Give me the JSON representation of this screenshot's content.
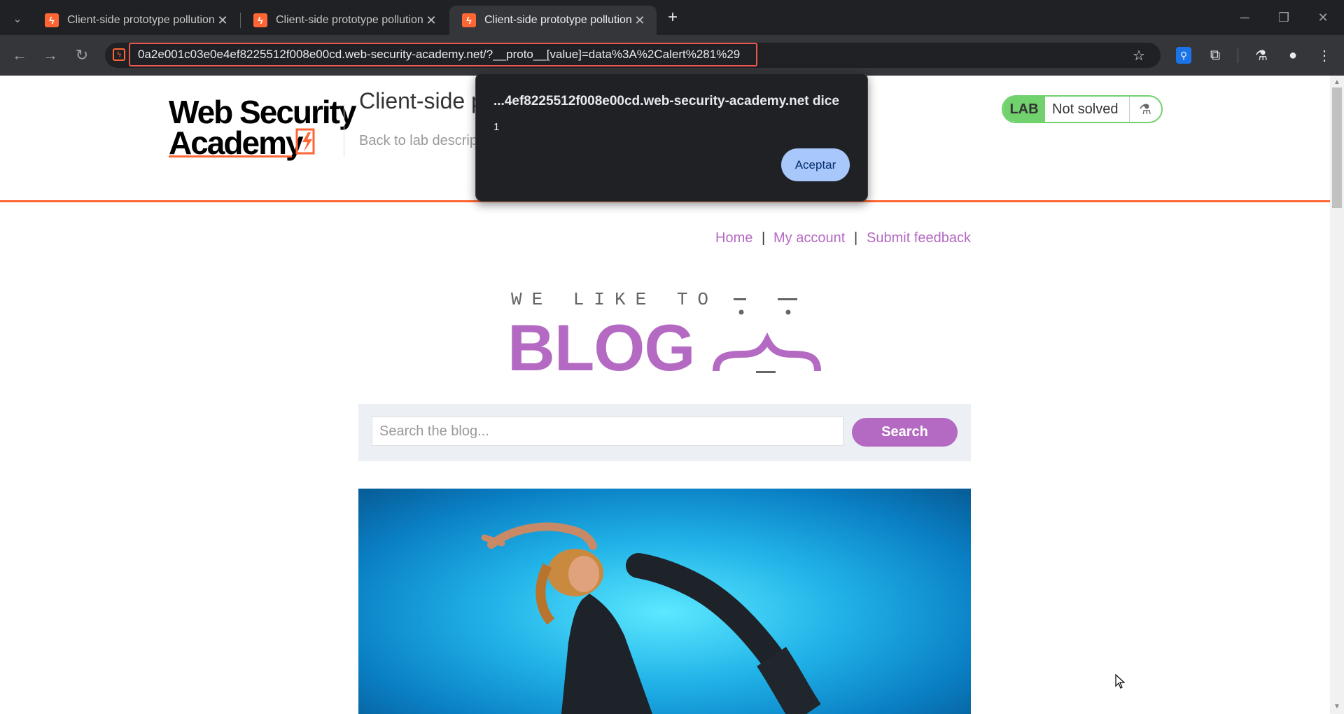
{
  "browser": {
    "tabs": [
      {
        "title": "Client-side prototype pollution",
        "active": false
      },
      {
        "title": "Client-side prototype pollution",
        "active": false
      },
      {
        "title": "Client-side prototype pollution",
        "active": true
      }
    ],
    "url": "0a2e001c03e0e4ef8225512f008e00cd.web-security-academy.net/?__proto__[value]=data%3A%2Calert%281%29"
  },
  "header": {
    "logo_line1": "Web Security",
    "logo_line2": "Academy",
    "lab_title": "Client-side p",
    "back_link": "Back to lab descrip",
    "lab_badge": "LAB",
    "lab_status": "Not solved"
  },
  "nav": {
    "home": "Home",
    "sep1": "|",
    "account": "My account",
    "sep2": "|",
    "feedback": "Submit feedback"
  },
  "blog": {
    "tagline": "WE LIKE TO",
    "title": "BLOG"
  },
  "search": {
    "placeholder": "Search the blog...",
    "button": "Search"
  },
  "dialog": {
    "title": "...4ef8225512f008e00cd.web-security-academy.net dice",
    "message": "1",
    "ok_button": "Aceptar"
  },
  "colors": {
    "accent_orange": "#ff6633",
    "blog_purple": "#b469c2",
    "lab_green": "#70d16d"
  }
}
